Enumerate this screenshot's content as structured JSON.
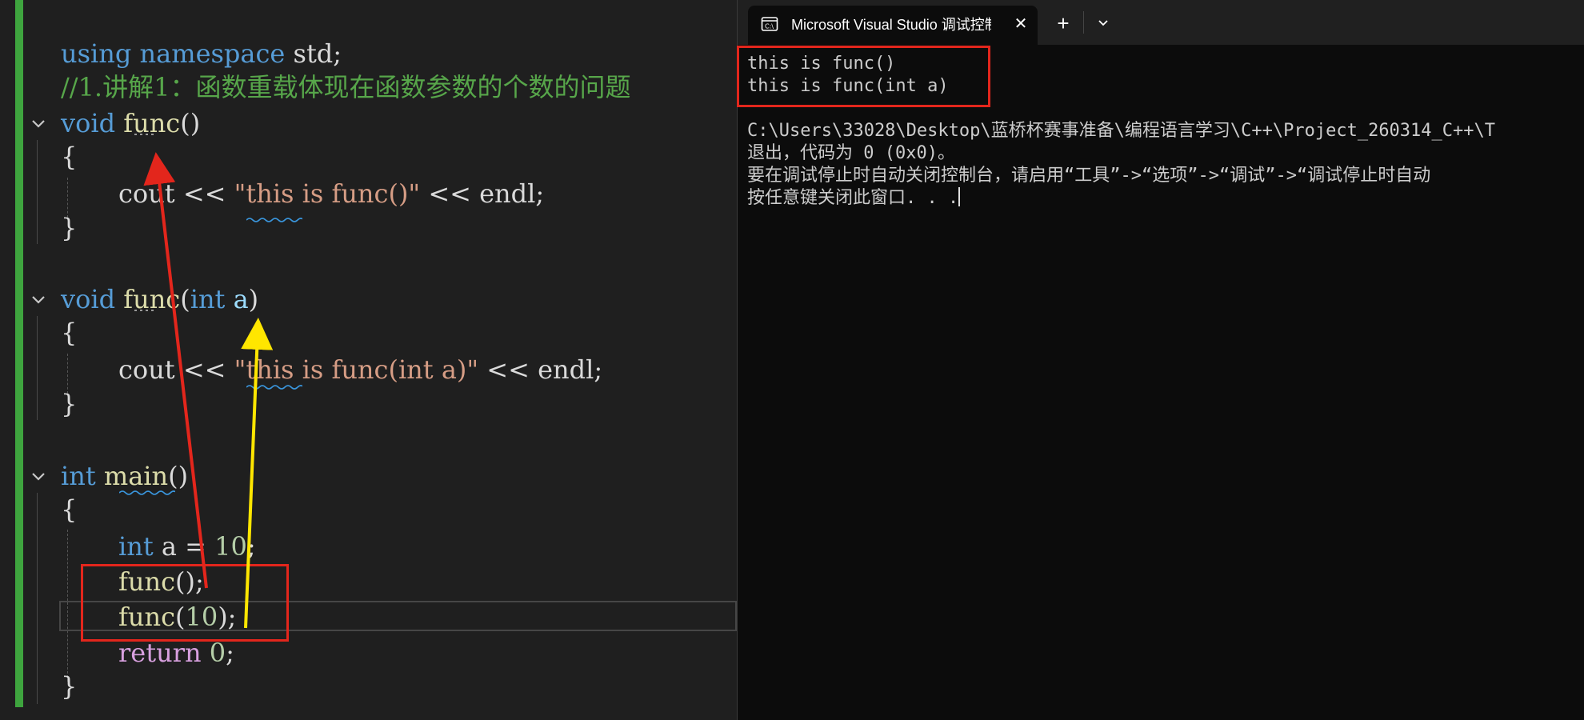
{
  "editor": {
    "lines": {
      "using": {
        "kw1": "using",
        "kw2": "namespace",
        "rest": " std;"
      },
      "comment": "//1.讲解1：函数重载体现在函数参数的个数的问题",
      "func1_sig": {
        "kw": "void",
        "name": "func",
        "rest": "()"
      },
      "brace_open": "{",
      "brace_close": "}",
      "func1_body": {
        "cout": "cout << ",
        "str": "\"this is func()\"",
        "rest": " << endl;"
      },
      "func2_sig": {
        "kw": "void",
        "name": "func",
        "paren_open": "(",
        "type": "int",
        "param": " a",
        "paren_close": ")"
      },
      "func2_body": {
        "cout": "cout << ",
        "str": "\"this is func(int a)\"",
        "rest": " << endl;"
      },
      "main_sig": {
        "kw": "int",
        "name": "main",
        "rest": "()"
      },
      "decl": {
        "kw": "int",
        "rest": " a = ",
        "num": "10",
        "semi": ";"
      },
      "call1": {
        "name": "func",
        "rest": "();"
      },
      "call2": {
        "name": "func",
        "paren": "(",
        "num": "10",
        "rest": ");"
      },
      "ret": {
        "kw": "return",
        "sp": " ",
        "num": "0",
        "semi": ";"
      }
    }
  },
  "console": {
    "tab_title": "Microsoft Visual Studio 调试控制台",
    "tab_close": "✕",
    "tab_add": "+",
    "output": [
      "this is func()",
      "this is func(int a)",
      "",
      "C:\\Users\\33028\\Desktop\\蓝桥杯赛事准备\\编程语言学习\\C++\\Project_260314_C++\\T",
      "退出，代码为 0 (0x0)。",
      "要在调试停止时自动关闭控制台，请启用“工具”->“选项”->“调试”->“调试停止时自动",
      "按任意键关闭此窗口. . ."
    ]
  },
  "colors": {
    "keyword": "#569cd6",
    "function": "#dcdcaa",
    "string": "#d69d85",
    "comment": "#57a64a",
    "number": "#b5cea8",
    "annotation_red": "#e3261c",
    "annotation_yellow": "#ffe600",
    "change_bar": "#3ea43e"
  }
}
